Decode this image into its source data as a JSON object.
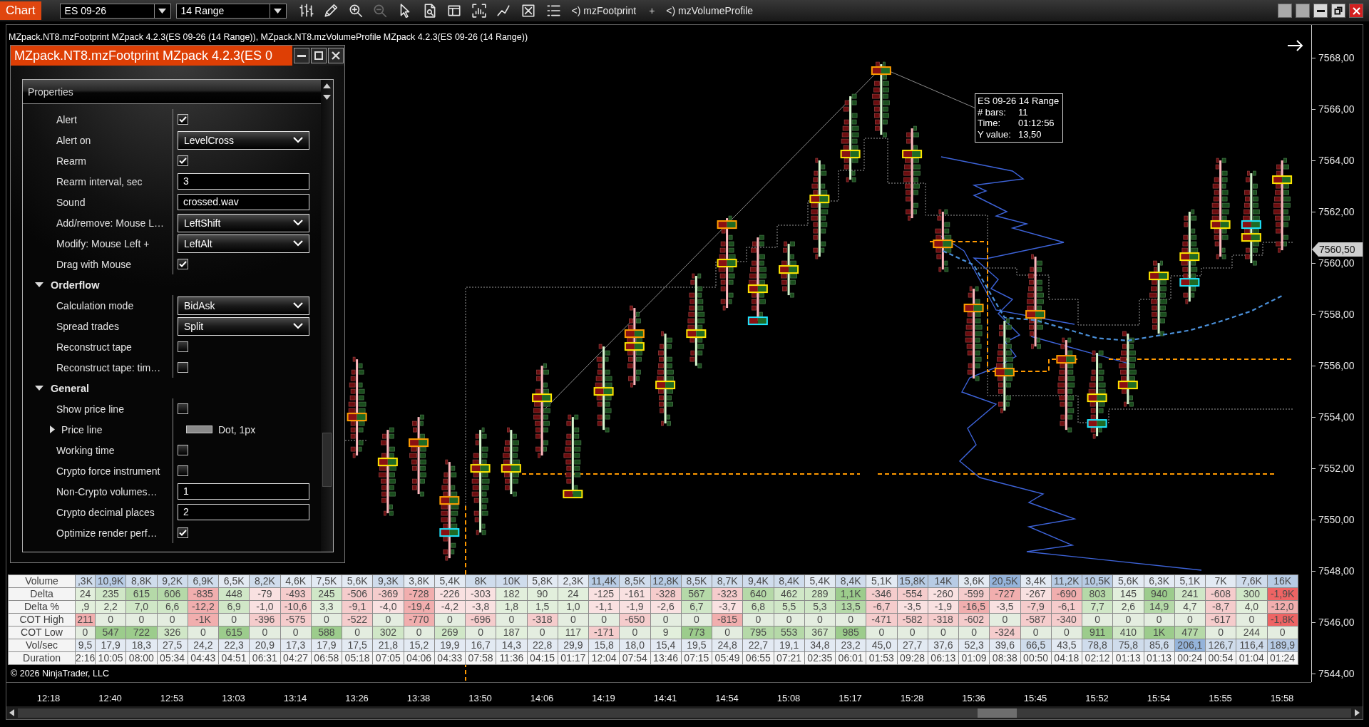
{
  "toolbar": {
    "tab": "Chart",
    "instrument": "ES 09-26",
    "bar_type": "14 Range",
    "indicators": [
      {
        "kind": "indicator",
        "text": "<) mzFootprint"
      },
      {
        "kind": "separator",
        "text": "+"
      },
      {
        "kind": "indicator",
        "text": "<) mzVolumeProfile"
      }
    ]
  },
  "chart": {
    "title_line": "MZpack.NT8.mzFootprint MZpack 4.2.3(ES 09-26 (14 Range)), MZpack.NT8.mzVolumeProfile MZpack 4.2.3(ES 09-26 (14 Range))",
    "tooltip": {
      "title": "ES 09-26 14 Range",
      "rows": [
        {
          "label": "# bars:",
          "value": "11"
        },
        {
          "label": "Time:",
          "value": "01:12:56"
        },
        {
          "label": "Y value:",
          "value": "13,50"
        }
      ]
    },
    "copyright": "© 2026 NinjaTrader, LLC",
    "last_price": "7560,50",
    "chart_data": {
      "type": "line",
      "categories": [
        "12:18",
        null,
        "12:40",
        null,
        "12:53",
        null,
        "13:03",
        null,
        "13:14",
        null,
        "13:26",
        null,
        "13:38",
        null,
        "13:50",
        null,
        "14:06",
        null,
        "14:19",
        null,
        "14:41",
        null,
        "14:54",
        null,
        "15:08",
        null,
        "15:17",
        null,
        "15:28",
        null,
        "15:36",
        null,
        "15:45",
        null,
        "15:52",
        null,
        "15:54",
        null,
        "15:55",
        null,
        "15:58"
      ],
      "series": [
        {
          "color": "#4a8fd8",
          "line_style": "dashed",
          "values": [
            null,
            null,
            null,
            null,
            null,
            null,
            null,
            null,
            null,
            null,
            null,
            null,
            null,
            null,
            null,
            null,
            null,
            null,
            null,
            null,
            null,
            null,
            null,
            null,
            null,
            null,
            null,
            null,
            null,
            7560.45,
            7559.9,
            7557.85,
            7557.75,
            7557.4,
            7557.05,
            7556.95,
            7557.15,
            7557.35,
            7557.7,
            7558.1,
            7558.7
          ]
        }
      ],
      "ylim": [
        7543.67,
        7569.28
      ],
      "yticks": [
        {
          "value": 7568,
          "label": "7568,00"
        },
        {
          "value": 7566,
          "label": "7566,00"
        },
        {
          "value": 7564,
          "label": "7564,00"
        },
        {
          "value": 7562,
          "label": "7562,00"
        },
        {
          "value": 7560,
          "label": "7560,00"
        },
        {
          "value": 7558,
          "label": "7558,00"
        },
        {
          "value": 7556,
          "label": "7556,00"
        },
        {
          "value": 7554,
          "label": "7554,00"
        },
        {
          "value": 7552,
          "label": "7552,00"
        },
        {
          "value": 7550,
          "label": "7550,00"
        },
        {
          "value": 7548,
          "label": "7548,00"
        },
        {
          "value": 7546,
          "label": "7546,00"
        },
        {
          "value": 7544,
          "label": "7544,00"
        }
      ]
    }
  },
  "properties_window": {
    "title": "MZpack.NT8.mzFootprint MZpack 4.2.3(ES 0",
    "header": "Properties",
    "rows": [
      {
        "kind": "checkbox",
        "label": "Alert",
        "checked": true
      },
      {
        "kind": "dropdown",
        "label": "Alert on",
        "value": "LevelCross"
      },
      {
        "kind": "checkbox",
        "label": "Rearm",
        "checked": true
      },
      {
        "kind": "text",
        "label": "Rearm interval, sec",
        "value": "3"
      },
      {
        "kind": "text",
        "label": "Sound",
        "value": "crossed.wav"
      },
      {
        "kind": "dropdown",
        "label": "Add/remove: Mouse L…",
        "value": "LeftShift"
      },
      {
        "kind": "dropdown",
        "label": "Modify: Mouse Left +",
        "value": "LeftAlt"
      },
      {
        "kind": "checkbox",
        "label": "Drag with Mouse",
        "checked": true
      },
      {
        "kind": "category",
        "label": "Orderflow",
        "expanded": true,
        "children": [
          {
            "kind": "dropdown",
            "label": "Calculation mode",
            "value": "BidAsk"
          },
          {
            "kind": "dropdown",
            "label": "Spread trades",
            "value": "Split"
          },
          {
            "kind": "checkbox",
            "label": "Reconstruct tape",
            "checked": false
          },
          {
            "kind": "checkbox",
            "label": "Reconstruct tape: tim…",
            "checked": false
          }
        ]
      },
      {
        "kind": "category",
        "label": "General",
        "expanded": true,
        "children": [
          {
            "kind": "checkbox",
            "label": "Show price line",
            "checked": false
          },
          {
            "kind": "stroke",
            "label": "Price line",
            "value": "Dot, 1px",
            "expanded": false
          },
          {
            "kind": "checkbox",
            "label": "Working time",
            "checked": false
          },
          {
            "kind": "checkbox",
            "label": "Crypto force instrument",
            "checked": false
          },
          {
            "kind": "text",
            "label": "Non-Crypto volumes…",
            "value": "1"
          },
          {
            "kind": "text",
            "label": "Crypto decimal places",
            "value": "2"
          },
          {
            "kind": "checkbox",
            "label": "Optimize render perf…",
            "checked": true
          }
        ]
      }
    ]
  },
  "stats_table": {
    "rows": [
      {
        "label": "Volume",
        "cells": [
          {
            "text": ",3K",
            "color": "#cfdcec"
          },
          {
            "text": "10,9K",
            "color": "#b7cbe4"
          },
          {
            "text": "8,8K",
            "color": "#cfdcec"
          },
          {
            "text": "9,2K",
            "color": "#cfdcec"
          },
          {
            "text": "6,9K",
            "color": "#cfdcec"
          },
          {
            "text": "6,5K",
            "color": "#e3eaf3"
          },
          {
            "text": "8,2K",
            "color": "#cfdcec"
          },
          {
            "text": "4,6K",
            "color": "#e3eaf3"
          },
          {
            "text": "7,5K",
            "color": "#e3eaf3"
          },
          {
            "text": "5,6K",
            "color": "#e3eaf3"
          },
          {
            "text": "9,3K",
            "color": "#cfdcec"
          },
          {
            "text": "3,8K",
            "color": "#e3eaf3"
          },
          {
            "text": "5,4K",
            "color": "#e3eaf3"
          },
          {
            "text": "8K",
            "color": "#cfdcec"
          },
          {
            "text": "10K",
            "color": "#cfdcec"
          },
          {
            "text": "5,8K",
            "color": "#e3eaf3"
          },
          {
            "text": "2,3K",
            "color": "#e3eaf3"
          },
          {
            "text": "11,4K",
            "color": "#b7cbe4"
          },
          {
            "text": "8,5K",
            "color": "#cfdcec"
          },
          {
            "text": "12,8K",
            "color": "#b7cbe4"
          },
          {
            "text": "8,5K",
            "color": "#cfdcec"
          },
          {
            "text": "8,7K",
            "color": "#cfdcec"
          },
          {
            "text": "9,4K",
            "color": "#cfdcec"
          },
          {
            "text": "8,4K",
            "color": "#cfdcec"
          },
          {
            "text": "5,4K",
            "color": "#e3eaf3"
          },
          {
            "text": "8,4K",
            "color": "#cfdcec"
          },
          {
            "text": "5,1K",
            "color": "#e3eaf3"
          },
          {
            "text": "15,8K",
            "color": "#b7cbe4"
          },
          {
            "text": "14K",
            "color": "#b7cbe4"
          },
          {
            "text": "3,6K",
            "color": "#e3eaf3"
          },
          {
            "text": "20,5K",
            "color": "#94b3da"
          },
          {
            "text": "3,4K",
            "color": "#e3eaf3"
          },
          {
            "text": "11,2K",
            "color": "#b7cbe4"
          },
          {
            "text": "10,5K",
            "color": "#b7cbe4"
          },
          {
            "text": "5,6K",
            "color": "#e3eaf3"
          },
          {
            "text": "6,3K",
            "color": "#e3eaf3"
          },
          {
            "text": "5,1K",
            "color": "#e3eaf3"
          },
          {
            "text": "7K",
            "color": "#e3eaf3"
          },
          {
            "text": "7,6K",
            "color": "#cfdcec"
          },
          {
            "text": "16K",
            "color": "#b7cbe4"
          }
        ]
      },
      {
        "label": "Delta",
        "cells": [
          {
            "text": "24",
            "color": "#e2efdc"
          },
          {
            "text": "235",
            "color": "#d0e7c7"
          },
          {
            "text": "615",
            "color": "#b5d9a8"
          },
          {
            "text": "606",
            "color": "#b5d9a8"
          },
          {
            "text": "-835",
            "color": "#f1aeae"
          },
          {
            "text": "448",
            "color": "#d0e7c7"
          },
          {
            "text": "-79",
            "color": "#f9e1e1"
          },
          {
            "text": "-493",
            "color": "#f5cccc"
          },
          {
            "text": "245",
            "color": "#d0e7c7"
          },
          {
            "text": "-506",
            "color": "#f5cccc"
          },
          {
            "text": "-369",
            "color": "#f5cccc"
          },
          {
            "text": "-728",
            "color": "#f1aeae"
          },
          {
            "text": "-226",
            "color": "#f9e1e1"
          },
          {
            "text": "-303",
            "color": "#f9e1e1"
          },
          {
            "text": "182",
            "color": "#e2efdc"
          },
          {
            "text": "90",
            "color": "#e2efdc"
          },
          {
            "text": "24",
            "color": "#e2efdc"
          },
          {
            "text": "-125",
            "color": "#f9e1e1"
          },
          {
            "text": "-161",
            "color": "#f9e1e1"
          },
          {
            "text": "-328",
            "color": "#f5cccc"
          },
          {
            "text": "567",
            "color": "#b5d9a8"
          },
          {
            "text": "-323",
            "color": "#f5cccc"
          },
          {
            "text": "640",
            "color": "#b5d9a8"
          },
          {
            "text": "462",
            "color": "#d0e7c7"
          },
          {
            "text": "289",
            "color": "#d0e7c7"
          },
          {
            "text": "1,1K",
            "color": "#9ccc8c"
          },
          {
            "text": "-346",
            "color": "#f5cccc"
          },
          {
            "text": "-554",
            "color": "#f5cccc"
          },
          {
            "text": "-260",
            "color": "#f9e1e1"
          },
          {
            "text": "-599",
            "color": "#f5cccc"
          },
          {
            "text": "-727",
            "color": "#f1aeae"
          },
          {
            "text": "-267",
            "color": "#f9e1e1"
          },
          {
            "text": "-690",
            "color": "#f1aeae"
          },
          {
            "text": "803",
            "color": "#b5d9a8"
          },
          {
            "text": "145",
            "color": "#e2efdc"
          },
          {
            "text": "940",
            "color": "#9ccc8c"
          },
          {
            "text": "241",
            "color": "#d0e7c7"
          },
          {
            "text": "-608",
            "color": "#f5cccc"
          },
          {
            "text": "300",
            "color": "#d0e7c7"
          },
          {
            "text": "-1,9K",
            "color": "#ee6464"
          }
        ]
      },
      {
        "label": "Delta %",
        "cells": [
          {
            "text": ",9",
            "color": "#e2efdc"
          },
          {
            "text": "2,2",
            "color": "#e2efdc"
          },
          {
            "text": "7,0",
            "color": "#d0e7c7"
          },
          {
            "text": "6,6",
            "color": "#d0e7c7"
          },
          {
            "text": "-12,2",
            "color": "#f1aeae"
          },
          {
            "text": "6,9",
            "color": "#d0e7c7"
          },
          {
            "text": "-1,0",
            "color": "#f9e1e1"
          },
          {
            "text": "-10,6",
            "color": "#f5cccc"
          },
          {
            "text": "3,3",
            "color": "#e2efdc"
          },
          {
            "text": "-9,1",
            "color": "#f5cccc"
          },
          {
            "text": "-4,0",
            "color": "#f9e1e1"
          },
          {
            "text": "-19,4",
            "color": "#f1aeae"
          },
          {
            "text": "-4,2",
            "color": "#f9e1e1"
          },
          {
            "text": "-3,8",
            "color": "#f9e1e1"
          },
          {
            "text": "1,8",
            "color": "#e2efdc"
          },
          {
            "text": "1,5",
            "color": "#e2efdc"
          },
          {
            "text": "1,0",
            "color": "#e2efdc"
          },
          {
            "text": "-1,1",
            "color": "#f9e1e1"
          },
          {
            "text": "-1,9",
            "color": "#f9e1e1"
          },
          {
            "text": "-2,6",
            "color": "#f9e1e1"
          },
          {
            "text": "6,7",
            "color": "#d0e7c7"
          },
          {
            "text": "-3,7",
            "color": "#f9e1e1"
          },
          {
            "text": "6,8",
            "color": "#d0e7c7"
          },
          {
            "text": "5,5",
            "color": "#d0e7c7"
          },
          {
            "text": "5,3",
            "color": "#d0e7c7"
          },
          {
            "text": "13,5",
            "color": "#b5d9a8"
          },
          {
            "text": "-6,7",
            "color": "#f5cccc"
          },
          {
            "text": "-3,5",
            "color": "#f9e1e1"
          },
          {
            "text": "-1,9",
            "color": "#f9e1e1"
          },
          {
            "text": "-16,5",
            "color": "#f1aeae"
          },
          {
            "text": "-3,5",
            "color": "#f9e1e1"
          },
          {
            "text": "-7,9",
            "color": "#f5cccc"
          },
          {
            "text": "-6,1",
            "color": "#f5cccc"
          },
          {
            "text": "7,7",
            "color": "#d0e7c7"
          },
          {
            "text": "2,6",
            "color": "#e2efdc"
          },
          {
            "text": "14,9",
            "color": "#b5d9a8"
          },
          {
            "text": "4,7",
            "color": "#e2efdc"
          },
          {
            "text": "-8,7",
            "color": "#f5cccc"
          },
          {
            "text": "4,0",
            "color": "#e2efdc"
          },
          {
            "text": "-12,0",
            "color": "#f1aeae"
          }
        ]
      },
      {
        "label": "COT High",
        "cells": [
          {
            "text": "211",
            "color": "#f1aeae"
          },
          {
            "text": "0",
            "color": "#e4ede0"
          },
          {
            "text": "0",
            "color": "#e4ede0"
          },
          {
            "text": "0",
            "color": "#e4ede0"
          },
          {
            "text": "-1K",
            "color": "#f1aeae"
          },
          {
            "text": "0",
            "color": "#e4ede0"
          },
          {
            "text": "-396",
            "color": "#f5cccc"
          },
          {
            "text": "-575",
            "color": "#f5cccc"
          },
          {
            "text": "0",
            "color": "#e4ede0"
          },
          {
            "text": "-522",
            "color": "#f5cccc"
          },
          {
            "text": "0",
            "color": "#e4ede0"
          },
          {
            "text": "-770",
            "color": "#f1aeae"
          },
          {
            "text": "0",
            "color": "#e4ede0"
          },
          {
            "text": "-696",
            "color": "#f5cccc"
          },
          {
            "text": "0",
            "color": "#e4ede0"
          },
          {
            "text": "-318",
            "color": "#f5cccc"
          },
          {
            "text": "0",
            "color": "#e4ede0"
          },
          {
            "text": "0",
            "color": "#e4ede0"
          },
          {
            "text": "-650",
            "color": "#f5cccc"
          },
          {
            "text": "0",
            "color": "#e4ede0"
          },
          {
            "text": "0",
            "color": "#e4ede0"
          },
          {
            "text": "-815",
            "color": "#f1aeae"
          },
          {
            "text": "0",
            "color": "#e4ede0"
          },
          {
            "text": "0",
            "color": "#e4ede0"
          },
          {
            "text": "0",
            "color": "#e4ede0"
          },
          {
            "text": "0",
            "color": "#e4ede0"
          },
          {
            "text": "-471",
            "color": "#f5cccc"
          },
          {
            "text": "-582",
            "color": "#f5cccc"
          },
          {
            "text": "-318",
            "color": "#f5cccc"
          },
          {
            "text": "-602",
            "color": "#f5cccc"
          },
          {
            "text": "0",
            "color": "#e4ede0"
          },
          {
            "text": "-587",
            "color": "#f5cccc"
          },
          {
            "text": "-340",
            "color": "#f5cccc"
          },
          {
            "text": "0",
            "color": "#e4ede0"
          },
          {
            "text": "0",
            "color": "#e4ede0"
          },
          {
            "text": "0",
            "color": "#e4ede0"
          },
          {
            "text": "0",
            "color": "#e4ede0"
          },
          {
            "text": "-617",
            "color": "#f5cccc"
          },
          {
            "text": "0",
            "color": "#e4ede0"
          },
          {
            "text": "-1,8K",
            "color": "#ee6464"
          }
        ]
      },
      {
        "label": "COT Low",
        "cells": [
          {
            "text": "0",
            "color": "#e4ede0"
          },
          {
            "text": "547",
            "color": "#9ccc8c"
          },
          {
            "text": "722",
            "color": "#9ccc8c"
          },
          {
            "text": "326",
            "color": "#d0e7c7"
          },
          {
            "text": "0",
            "color": "#e4ede0"
          },
          {
            "text": "615",
            "color": "#9ccc8c"
          },
          {
            "text": "0",
            "color": "#e4ede0"
          },
          {
            "text": "0",
            "color": "#e4ede0"
          },
          {
            "text": "588",
            "color": "#9ccc8c"
          },
          {
            "text": "0",
            "color": "#e4ede0"
          },
          {
            "text": "302",
            "color": "#d0e7c7"
          },
          {
            "text": "0",
            "color": "#e4ede0"
          },
          {
            "text": "269",
            "color": "#d0e7c7"
          },
          {
            "text": "0",
            "color": "#e4ede0"
          },
          {
            "text": "187",
            "color": "#e2efdc"
          },
          {
            "text": "0",
            "color": "#e4ede0"
          },
          {
            "text": "117",
            "color": "#e2efdc"
          },
          {
            "text": "-171",
            "color": "#f5cccc"
          },
          {
            "text": "0",
            "color": "#e4ede0"
          },
          {
            "text": "9",
            "color": "#e2efdc"
          },
          {
            "text": "773",
            "color": "#9ccc8c"
          },
          {
            "text": "0",
            "color": "#e4ede0"
          },
          {
            "text": "795",
            "color": "#b5d9a8"
          },
          {
            "text": "553",
            "color": "#b5d9a8"
          },
          {
            "text": "367",
            "color": "#d0e7c7"
          },
          {
            "text": "985",
            "color": "#9ccc8c"
          },
          {
            "text": "0",
            "color": "#e4ede0"
          },
          {
            "text": "0",
            "color": "#e4ede0"
          },
          {
            "text": "0",
            "color": "#e4ede0"
          },
          {
            "text": "0",
            "color": "#e4ede0"
          },
          {
            "text": "-324",
            "color": "#f5cccc"
          },
          {
            "text": "0",
            "color": "#e4ede0"
          },
          {
            "text": "0",
            "color": "#e4ede0"
          },
          {
            "text": "911",
            "color": "#9ccc8c"
          },
          {
            "text": "410",
            "color": "#d0e7c7"
          },
          {
            "text": "1K",
            "color": "#9ccc8c"
          },
          {
            "text": "477",
            "color": "#b5d9a8"
          },
          {
            "text": "0",
            "color": "#e4ede0"
          },
          {
            "text": "244",
            "color": "#e2efdc"
          },
          {
            "text": "0",
            "color": "#e4ede0"
          }
        ]
      },
      {
        "label": "Vol/sec",
        "cells": [
          {
            "text": "9,5",
            "color": "#e3eaf3"
          },
          {
            "text": "17,9",
            "color": "#e3eaf3"
          },
          {
            "text": "18,3",
            "color": "#e3eaf3"
          },
          {
            "text": "27,5",
            "color": "#e3eaf3"
          },
          {
            "text": "24,2",
            "color": "#e3eaf3"
          },
          {
            "text": "22,3",
            "color": "#e3eaf3"
          },
          {
            "text": "20,9",
            "color": "#e3eaf3"
          },
          {
            "text": "17,3",
            "color": "#e3eaf3"
          },
          {
            "text": "17,9",
            "color": "#e3eaf3"
          },
          {
            "text": "17,5",
            "color": "#e3eaf3"
          },
          {
            "text": "21,8",
            "color": "#e3eaf3"
          },
          {
            "text": "15,2",
            "color": "#e3eaf3"
          },
          {
            "text": "19,9",
            "color": "#e3eaf3"
          },
          {
            "text": "16,7",
            "color": "#e3eaf3"
          },
          {
            "text": "14,3",
            "color": "#e3eaf3"
          },
          {
            "text": "22,8",
            "color": "#e3eaf3"
          },
          {
            "text": "29,9",
            "color": "#e3eaf3"
          },
          {
            "text": "15,8",
            "color": "#e3eaf3"
          },
          {
            "text": "18,0",
            "color": "#e3eaf3"
          },
          {
            "text": "15,4",
            "color": "#e3eaf3"
          },
          {
            "text": "19,5",
            "color": "#e3eaf3"
          },
          {
            "text": "24,8",
            "color": "#e3eaf3"
          },
          {
            "text": "22,7",
            "color": "#e3eaf3"
          },
          {
            "text": "19,1",
            "color": "#e3eaf3"
          },
          {
            "text": "34,8",
            "color": "#e3eaf3"
          },
          {
            "text": "23,2",
            "color": "#e3eaf3"
          },
          {
            "text": "45,0",
            "color": "#e3eaf3"
          },
          {
            "text": "27,7",
            "color": "#e3eaf3"
          },
          {
            "text": "37,6",
            "color": "#e3eaf3"
          },
          {
            "text": "52,3",
            "color": "#e3eaf3"
          },
          {
            "text": "39,6",
            "color": "#e3eaf3"
          },
          {
            "text": "66,5",
            "color": "#cfdcec"
          },
          {
            "text": "43,5",
            "color": "#e3eaf3"
          },
          {
            "text": "78,8",
            "color": "#cfdcec"
          },
          {
            "text": "75,8",
            "color": "#cfdcec"
          },
          {
            "text": "85,6",
            "color": "#cfdcec"
          },
          {
            "text": "206,1",
            "color": "#94b3da"
          },
          {
            "text": "126,7",
            "color": "#cfdcec"
          },
          {
            "text": "116,4",
            "color": "#cfdcec"
          },
          {
            "text": "189,9",
            "color": "#b7cbe4"
          }
        ]
      },
      {
        "label": "Duration",
        "cells": [
          {
            "text": "2:16"
          },
          {
            "text": "10:05"
          },
          {
            "text": "08:00"
          },
          {
            "text": "05:34"
          },
          {
            "text": "04:43"
          },
          {
            "text": "04:51"
          },
          {
            "text": "06:31"
          },
          {
            "text": "04:27"
          },
          {
            "text": "06:58"
          },
          {
            "text": "05:18"
          },
          {
            "text": "07:05"
          },
          {
            "text": "04:06"
          },
          {
            "text": "04:33"
          },
          {
            "text": "07:58"
          },
          {
            "text": "11:36"
          },
          {
            "text": "04:15"
          },
          {
            "text": "01:17"
          },
          {
            "text": "12:04"
          },
          {
            "text": "07:54"
          },
          {
            "text": "13:46"
          },
          {
            "text": "07:15"
          },
          {
            "text": "05:49"
          },
          {
            "text": "06:55"
          },
          {
            "text": "07:21"
          },
          {
            "text": "02:35"
          },
          {
            "text": "06:01"
          },
          {
            "text": "01:53"
          },
          {
            "text": "09:28"
          },
          {
            "text": "06:13"
          },
          {
            "text": "01:09"
          },
          {
            "text": "08:38"
          },
          {
            "text": "00:50"
          },
          {
            "text": "04:18"
          },
          {
            "text": "02:12"
          },
          {
            "text": "01:13"
          },
          {
            "text": "01:13"
          },
          {
            "text": "00:24"
          },
          {
            "text": "00:54"
          },
          {
            "text": "01:04"
          },
          {
            "text": "01:24"
          }
        ]
      }
    ]
  }
}
